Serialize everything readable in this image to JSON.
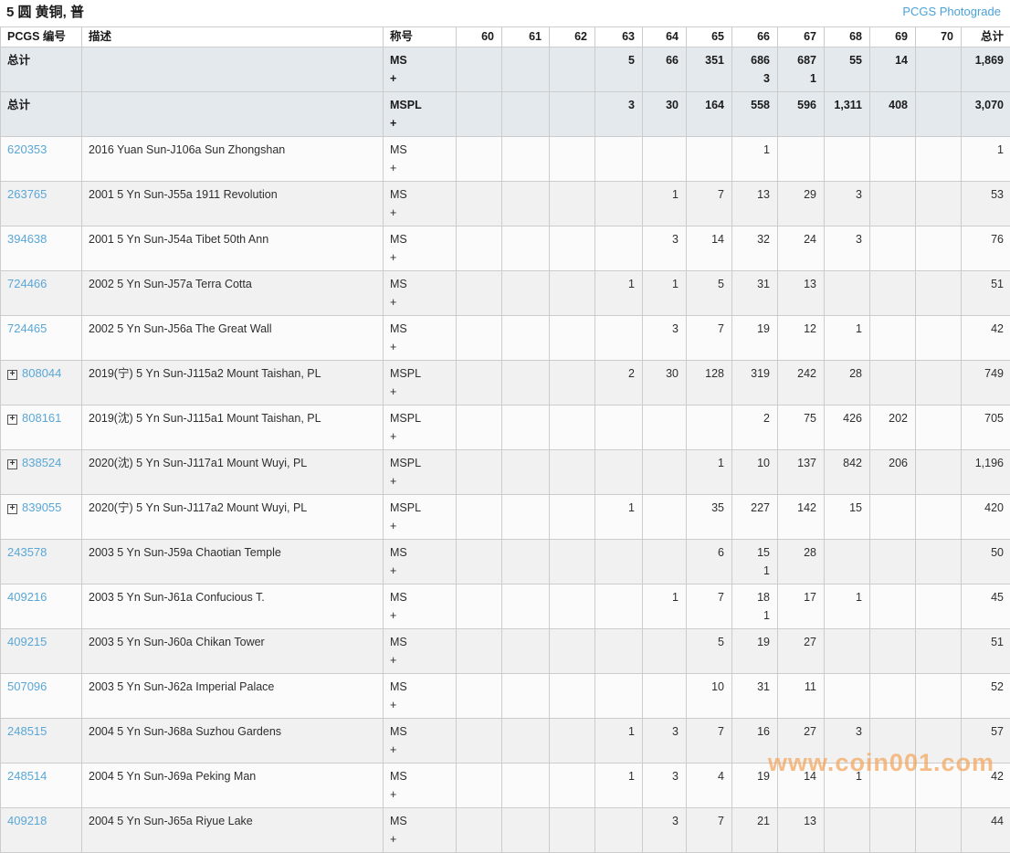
{
  "title": "5 圆 黄铜, 普",
  "photograde_link": "PCGS Photograde",
  "watermark": "www.coin001.com",
  "icons": {
    "expand_plus": "+"
  },
  "colors": {
    "link_blue": "#5aa7d7",
    "photograde_blue": "#4ba2d9",
    "summary_row_bg": "#e4e9ee",
    "stripe_gray": "#f1f1f1",
    "stripe_white": "#fbfbfb",
    "watermark_orange": "#f3a55c",
    "border": "#cccccc"
  },
  "columns": [
    "PCGS 编号",
    "描述",
    "称号",
    "60",
    "61",
    "62",
    "63",
    "64",
    "65",
    "66",
    "67",
    "68",
    "69",
    "70",
    "总计"
  ],
  "summary_rows": [
    {
      "label": "总计",
      "designation": "MS\n+",
      "cells": [
        "",
        "",
        "",
        "5",
        "66",
        "351",
        "686\n3",
        "687\n1",
        "55",
        "14",
        "",
        "1,869"
      ]
    },
    {
      "label": "总计",
      "designation": "MSPL\n+",
      "cells": [
        "",
        "",
        "",
        "3",
        "30",
        "164",
        "558",
        "596",
        "1,311",
        "408",
        "",
        "3,070"
      ]
    }
  ],
  "rows": [
    {
      "pcgs_number": "620353",
      "expandable": false,
      "description": "2016 Yuan Sun-J106a Sun Zhongshan",
      "designation": "MS\n+",
      "cells": [
        "",
        "",
        "",
        "",
        "",
        "",
        "1",
        "",
        "",
        "",
        "",
        "1"
      ]
    },
    {
      "pcgs_number": "263765",
      "expandable": false,
      "description": "2001 5 Yn Sun-J55a 1911 Revolution",
      "designation": "MS\n+",
      "cells": [
        "",
        "",
        "",
        "",
        "1",
        "7",
        "13",
        "29",
        "3",
        "",
        "",
        "53"
      ]
    },
    {
      "pcgs_number": "394638",
      "expandable": false,
      "description": "2001 5 Yn Sun-J54a Tibet 50th Ann",
      "designation": "MS\n+",
      "cells": [
        "",
        "",
        "",
        "",
        "3",
        "14",
        "32",
        "24",
        "3",
        "",
        "",
        "76"
      ]
    },
    {
      "pcgs_number": "724466",
      "expandable": false,
      "description": "2002 5 Yn Sun-J57a Terra Cotta",
      "designation": "MS\n+",
      "cells": [
        "",
        "",
        "",
        "1",
        "1",
        "5",
        "31",
        "13",
        "",
        "",
        "",
        "51"
      ]
    },
    {
      "pcgs_number": "724465",
      "expandable": false,
      "description": "2002 5 Yn Sun-J56a The Great Wall",
      "designation": "MS\n+",
      "cells": [
        "",
        "",
        "",
        "",
        "3",
        "7",
        "19",
        "12",
        "1",
        "",
        "",
        "42"
      ]
    },
    {
      "pcgs_number": "808044",
      "expandable": true,
      "description": "2019(宁) 5 Yn Sun-J115a2 Mount Taishan, PL",
      "designation": "MSPL\n+",
      "cells": [
        "",
        "",
        "",
        "2",
        "30",
        "128",
        "319",
        "242",
        "28",
        "",
        "",
        "749"
      ]
    },
    {
      "pcgs_number": "808161",
      "expandable": true,
      "description": "2019(沈) 5 Yn Sun-J115a1 Mount Taishan, PL",
      "designation": "MSPL\n+",
      "cells": [
        "",
        "",
        "",
        "",
        "",
        "",
        "2",
        "75",
        "426",
        "202",
        "",
        "705"
      ]
    },
    {
      "pcgs_number": "838524",
      "expandable": true,
      "description": "2020(沈) 5 Yn Sun-J117a1 Mount Wuyi, PL",
      "designation": "MSPL\n+",
      "cells": [
        "",
        "",
        "",
        "",
        "",
        "1",
        "10",
        "137",
        "842",
        "206",
        "",
        "1,196"
      ]
    },
    {
      "pcgs_number": "839055",
      "expandable": true,
      "description": "2020(宁) 5 Yn Sun-J117a2 Mount Wuyi, PL",
      "designation": "MSPL\n+",
      "cells": [
        "",
        "",
        "",
        "1",
        "",
        "35",
        "227",
        "142",
        "15",
        "",
        "",
        "420"
      ]
    },
    {
      "pcgs_number": "243578",
      "expandable": false,
      "description": "2003 5 Yn Sun-J59a Chaotian Temple",
      "designation": "MS\n+",
      "cells": [
        "",
        "",
        "",
        "",
        "",
        "6",
        "15\n1",
        "28",
        "",
        "",
        "",
        "50"
      ]
    },
    {
      "pcgs_number": "409216",
      "expandable": false,
      "description": "2003 5 Yn Sun-J61a Confucious T.",
      "designation": "MS\n+",
      "cells": [
        "",
        "",
        "",
        "",
        "1",
        "7",
        "18\n1",
        "17",
        "1",
        "",
        "",
        "45"
      ]
    },
    {
      "pcgs_number": "409215",
      "expandable": false,
      "description": "2003 5 Yn Sun-J60a Chikan Tower",
      "designation": "MS\n+",
      "cells": [
        "",
        "",
        "",
        "",
        "",
        "5",
        "19",
        "27",
        "",
        "",
        "",
        "51"
      ]
    },
    {
      "pcgs_number": "507096",
      "expandable": false,
      "description": "2003 5 Yn Sun-J62a Imperial Palace",
      "designation": "MS\n+",
      "cells": [
        "",
        "",
        "",
        "",
        "",
        "10",
        "31",
        "11",
        "",
        "",
        "",
        "52"
      ]
    },
    {
      "pcgs_number": "248515",
      "expandable": false,
      "description": "2004 5 Yn Sun-J68a Suzhou Gardens",
      "designation": "MS\n+",
      "cells": [
        "",
        "",
        "",
        "1",
        "3",
        "7",
        "16",
        "27",
        "3",
        "",
        "",
        "57"
      ]
    },
    {
      "pcgs_number": "248514",
      "expandable": false,
      "description": "2004 5 Yn Sun-J69a Peking Man",
      "designation": "MS\n+",
      "cells": [
        "",
        "",
        "",
        "1",
        "3",
        "4",
        "19",
        "14",
        "1",
        "",
        "",
        "42"
      ]
    },
    {
      "pcgs_number": "409218",
      "expandable": false,
      "description": "2004 5 Yn Sun-J65a Riyue Lake",
      "designation": "MS\n+",
      "cells": [
        "",
        "",
        "",
        "",
        "3",
        "7",
        "21",
        "13",
        "",
        "",
        "",
        "44"
      ]
    }
  ]
}
